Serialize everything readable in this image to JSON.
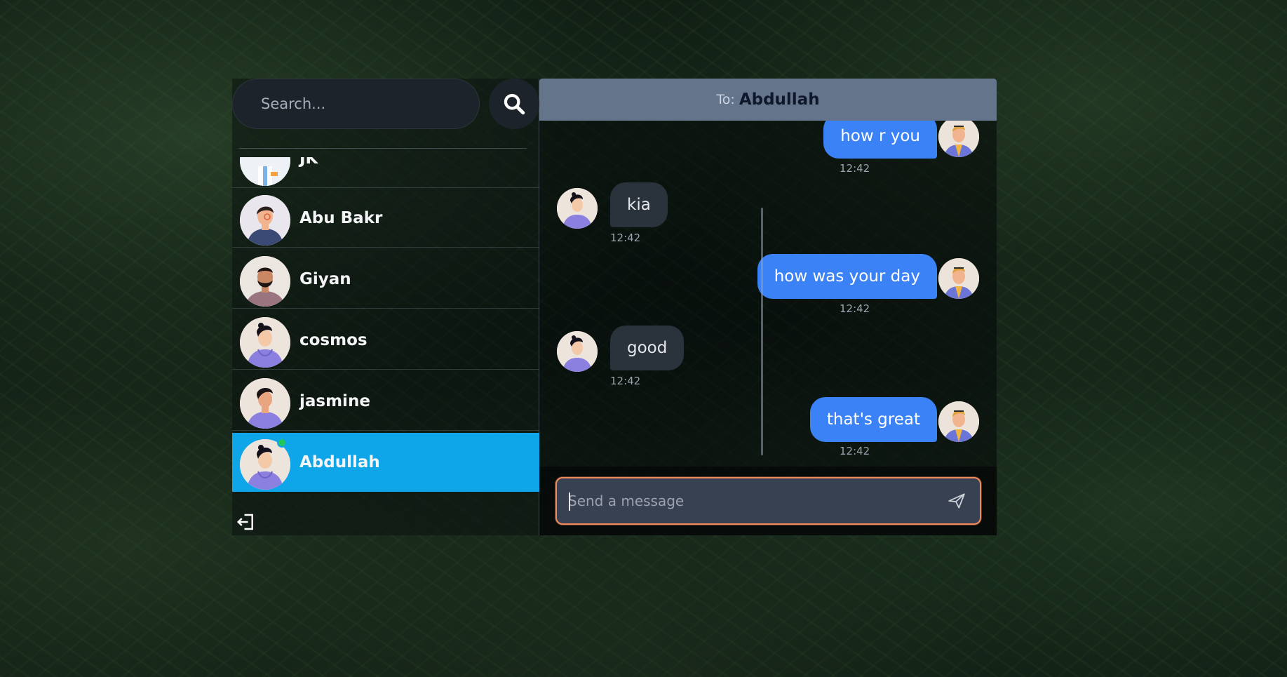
{
  "search": {
    "placeholder": "Search..."
  },
  "conversations": [
    {
      "name": "JK",
      "online": false,
      "active": false
    },
    {
      "name": "Abu Bakr",
      "online": false,
      "active": false
    },
    {
      "name": "Giyan",
      "online": false,
      "active": false
    },
    {
      "name": "cosmos",
      "online": false,
      "active": false
    },
    {
      "name": "jasmine",
      "online": false,
      "active": false
    },
    {
      "name": "Abdullah",
      "online": true,
      "active": true
    }
  ],
  "chat": {
    "to_label": "To:",
    "to_name": "Abdullah",
    "messages": [
      {
        "from": "me",
        "text": "how r you",
        "time": "12:42"
      },
      {
        "from": "them",
        "text": "kia",
        "time": "12:42"
      },
      {
        "from": "me",
        "text": "how was your day",
        "time": "12:42"
      },
      {
        "from": "them",
        "text": "good",
        "time": "12:42"
      },
      {
        "from": "me",
        "text": "that's great",
        "time": "12:42"
      }
    ]
  },
  "composer": {
    "placeholder": "Send a message"
  },
  "colors": {
    "active_item": "#0ea5e9",
    "outgoing_bubble": "#3b82f6",
    "incoming_bubble": "#2a323c",
    "header": "#64748b",
    "composer_border": "#f08a5d",
    "online": "#22c55e"
  },
  "icons": {
    "search": "search-icon",
    "logout": "logout-icon",
    "send": "send-icon"
  }
}
